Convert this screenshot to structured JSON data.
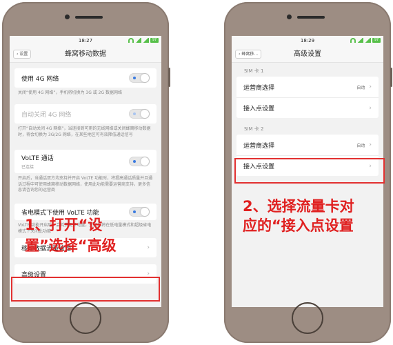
{
  "colors": {
    "accent": "#3a7be0",
    "highlight": "#e23030",
    "phone_body": "#9d8d83",
    "status_green": "#57c04a"
  },
  "phone1": {
    "status": {
      "time": "18:27",
      "battery": "97"
    },
    "nav": {
      "back_label": "设置",
      "title": "蜂窝移动数据"
    },
    "use_4g": {
      "label": "使用 4G 网络",
      "desc": "关闭“使用 4G 网络”，手机将切换为 3G 或 2G 数据网络"
    },
    "auto_off_4g": {
      "label": "自动关闭 4G 网络",
      "desc": "打开“自动关闭 4G 网络”，当连接到可用的无线网络或关闭蜂窝移动数据时，将会切换为 3G/2G 网络，在某些地区可有效降低通话信号"
    },
    "volte": {
      "label": "VoLTE 通话",
      "sub": "已连接",
      "desc": "开启后，当通话双方均支持并开启 VoLTE 功能时，将提高通话质量并且通话过程中可使用蜂窝移动数据网络，使用此功能需要运营商支持，更多信息请咨询您的运营商"
    },
    "power_save_volte": {
      "label": "省电模式下使用 VoLTE 功能",
      "desc": "VoLTE 功能开启后，会耗费更多电量，关闭后将在低电量模式和超级省电模式下关闭此功能"
    },
    "traffic_mgmt": {
      "label": "移动数据流量管理"
    },
    "advanced": {
      "label": "高级设置"
    },
    "annotation": {
      "line1": "1、打开“设",
      "line2": "置”选择“高级"
    }
  },
  "phone2": {
    "status": {
      "time": "18:29",
      "battery": "97"
    },
    "nav": {
      "back_label": "蜂窝移...",
      "title": "高级设置"
    },
    "sim1": {
      "title": "SIM 卡 1",
      "carrier_label": "运营商选择",
      "carrier_value": "自动",
      "apn_label": "接入点设置"
    },
    "sim2": {
      "title": "SIM 卡 2",
      "carrier_label": "运营商选择",
      "carrier_value": "自动",
      "apn_label": "接入点设置"
    },
    "annotation": {
      "line1": "2、选择流量卡对",
      "line2": "应的“接入点设置"
    }
  }
}
